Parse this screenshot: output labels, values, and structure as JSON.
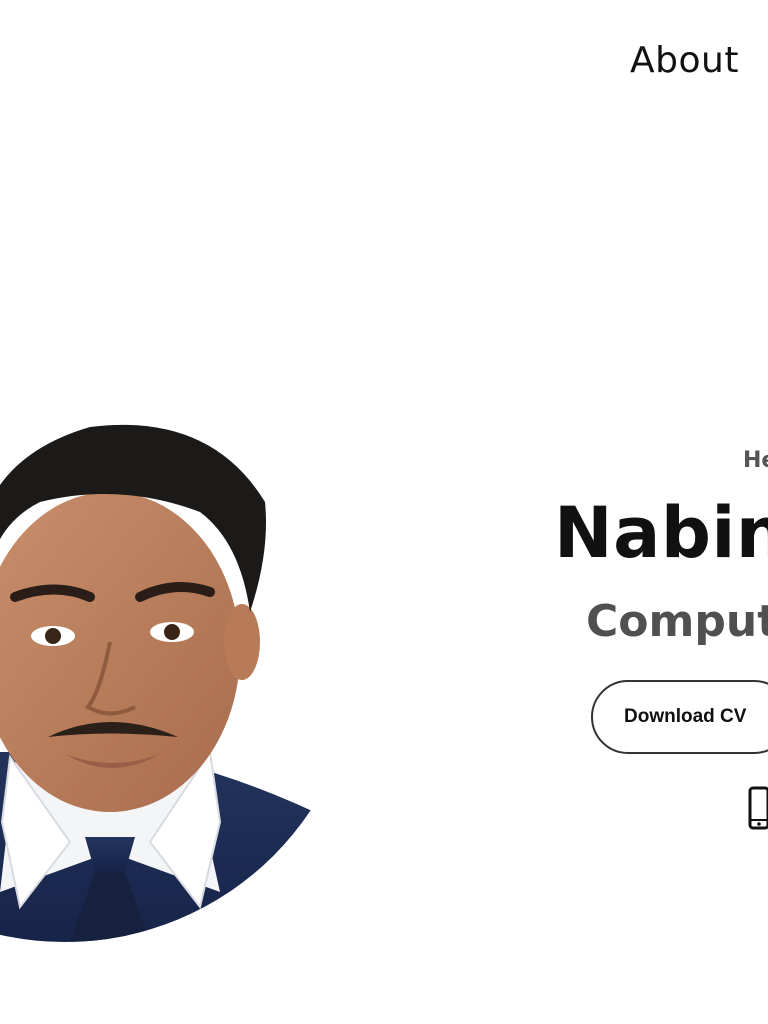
{
  "nav": {
    "about_label": "About"
  },
  "hero": {
    "greeting": "He",
    "name": "Nabin",
    "role": "Comput",
    "download_cv_label": "Download CV"
  },
  "icons": {
    "contact": "phone-icon"
  },
  "colors": {
    "text_primary": "#111111",
    "text_secondary": "#505050",
    "button_border": "#333333",
    "suit": "#1b2a4e",
    "tie": "#16213f"
  }
}
